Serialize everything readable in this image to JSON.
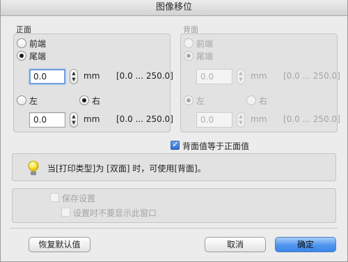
{
  "window": {
    "title": "图像移位"
  },
  "front": {
    "title": "正面",
    "options": {
      "front_end": "前端",
      "tail_end": "尾端",
      "left": "左",
      "right": "右"
    },
    "selected_vertical": "尾端",
    "selected_horizontal": "右",
    "vertical_value": "0.0",
    "horizontal_value": "0.0",
    "unit": "mm",
    "range": "[0.0 ... 250.0]"
  },
  "back": {
    "title": "背面",
    "options": {
      "front_end": "前端",
      "tail_end": "尾端",
      "left": "左",
      "right": "右"
    },
    "selected_vertical": "尾端",
    "selected_horizontal": "左",
    "vertical_value": "0.0",
    "horizontal_value": "0.0",
    "unit": "mm",
    "range": "[0.0 ... 250.0]",
    "disabled": true
  },
  "same_as_front": {
    "label": "背面值等于正面值",
    "checked": true
  },
  "info": {
    "text": "当[打印类型]为 [双面] 时，可使用[背面]。",
    "icon": "lightbulb-icon"
  },
  "settings": {
    "save_label": "保存设置",
    "dont_show_label": "设置时不要显示此窗口"
  },
  "buttons": {
    "restore_defaults": "恢复默认值",
    "cancel": "取消",
    "ok": "确定"
  },
  "colors": {
    "accent": "#3c86ea",
    "focus": "#6ea0e0"
  }
}
